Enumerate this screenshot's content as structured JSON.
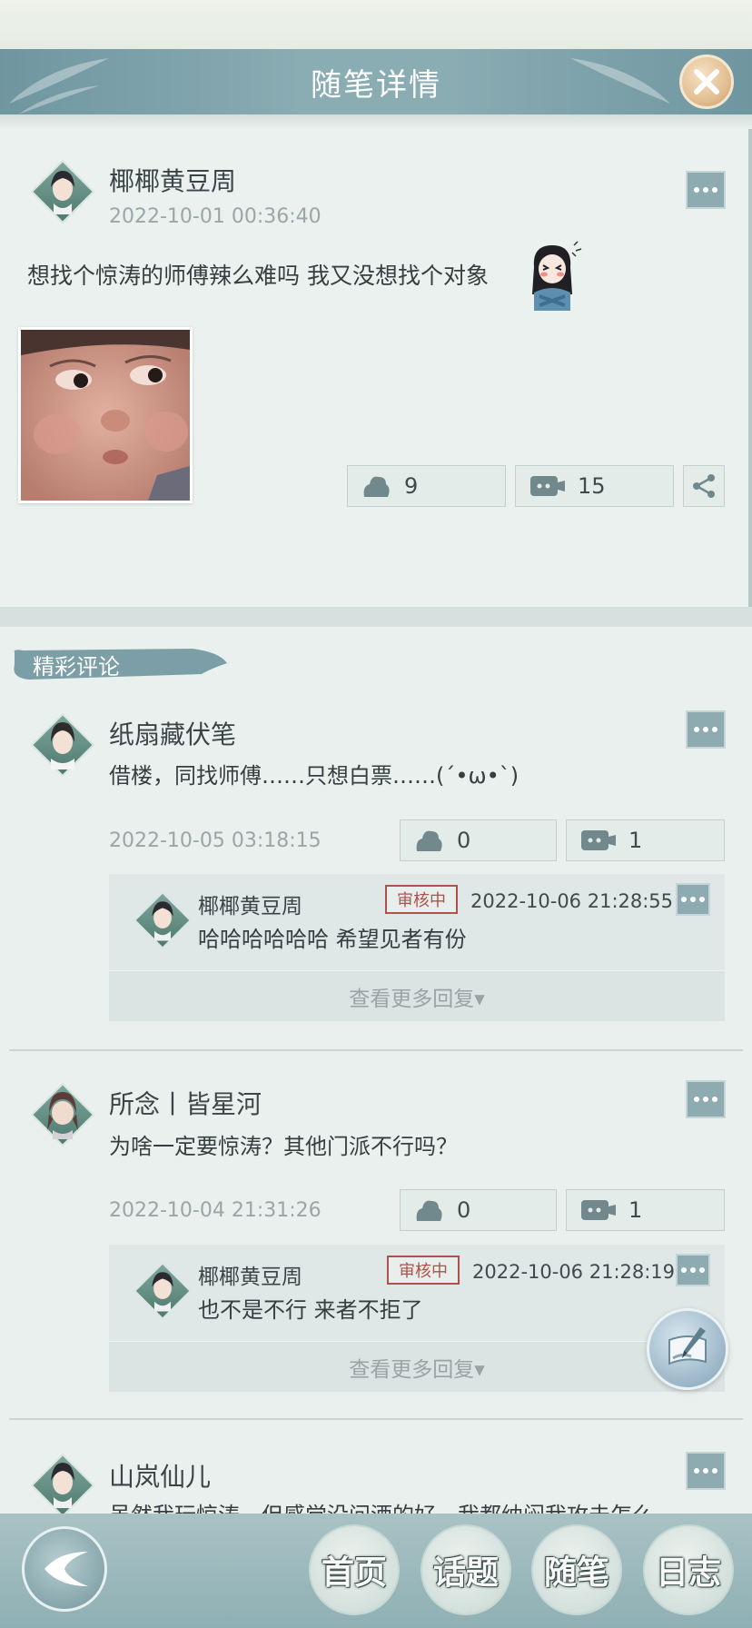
{
  "header": {
    "title": "随笔详情"
  },
  "post": {
    "author": "椰椰黄豆周",
    "time": "2022-10-01 00:36:40",
    "text": "想找个惊涛的师傅辣么难吗 我又没想找个对象",
    "likes": "9",
    "comments": "15"
  },
  "comments_section": {
    "label": "精彩评论",
    "more_replies_label": "查看更多回复▾",
    "review_stamp": "审核中",
    "items": [
      {
        "author": "纸扇藏伏笔",
        "text": "借楼，同找师傅……只想白票……(´•ω•`)",
        "time": "2022-10-05 03:18:15",
        "likes": "0",
        "comments": "1",
        "reply": {
          "author": "椰椰黄豆周",
          "time": "2022-10-06 21:28:55",
          "text": "哈哈哈哈哈哈 希望见者有份"
        }
      },
      {
        "author": "所念丨皆星河",
        "text": "为啥一定要惊涛？其他门派不行吗？",
        "time": "2022-10-04 21:31:26",
        "likes": "0",
        "comments": "1",
        "reply": {
          "author": "椰椰黄豆周",
          "time": "2022-10-06 21:28:19",
          "text": "也不是不行 来者不拒了"
        }
      },
      {
        "author": "山岚仙儿",
        "text": "虽然我玩惊涛，但感觉没问酒的好，我都纳闷我攻击怎么"
      }
    ]
  },
  "nav": {
    "items": [
      "首页",
      "话题",
      "随笔",
      "日志"
    ]
  },
  "icons": {
    "close": "close-icon",
    "more": "more-dots-icon",
    "like": "flower-bud-icon",
    "comment": "comment-icon",
    "share": "share-icon",
    "write": "brush-write-icon",
    "back": "back-arrow-icon"
  },
  "colors": {
    "title_bar": "#8aacb3",
    "close_button": "#e2bf93",
    "more_button": "#8eabb2",
    "review_stamp": "#b0504a",
    "background": "#e9f0ee"
  }
}
